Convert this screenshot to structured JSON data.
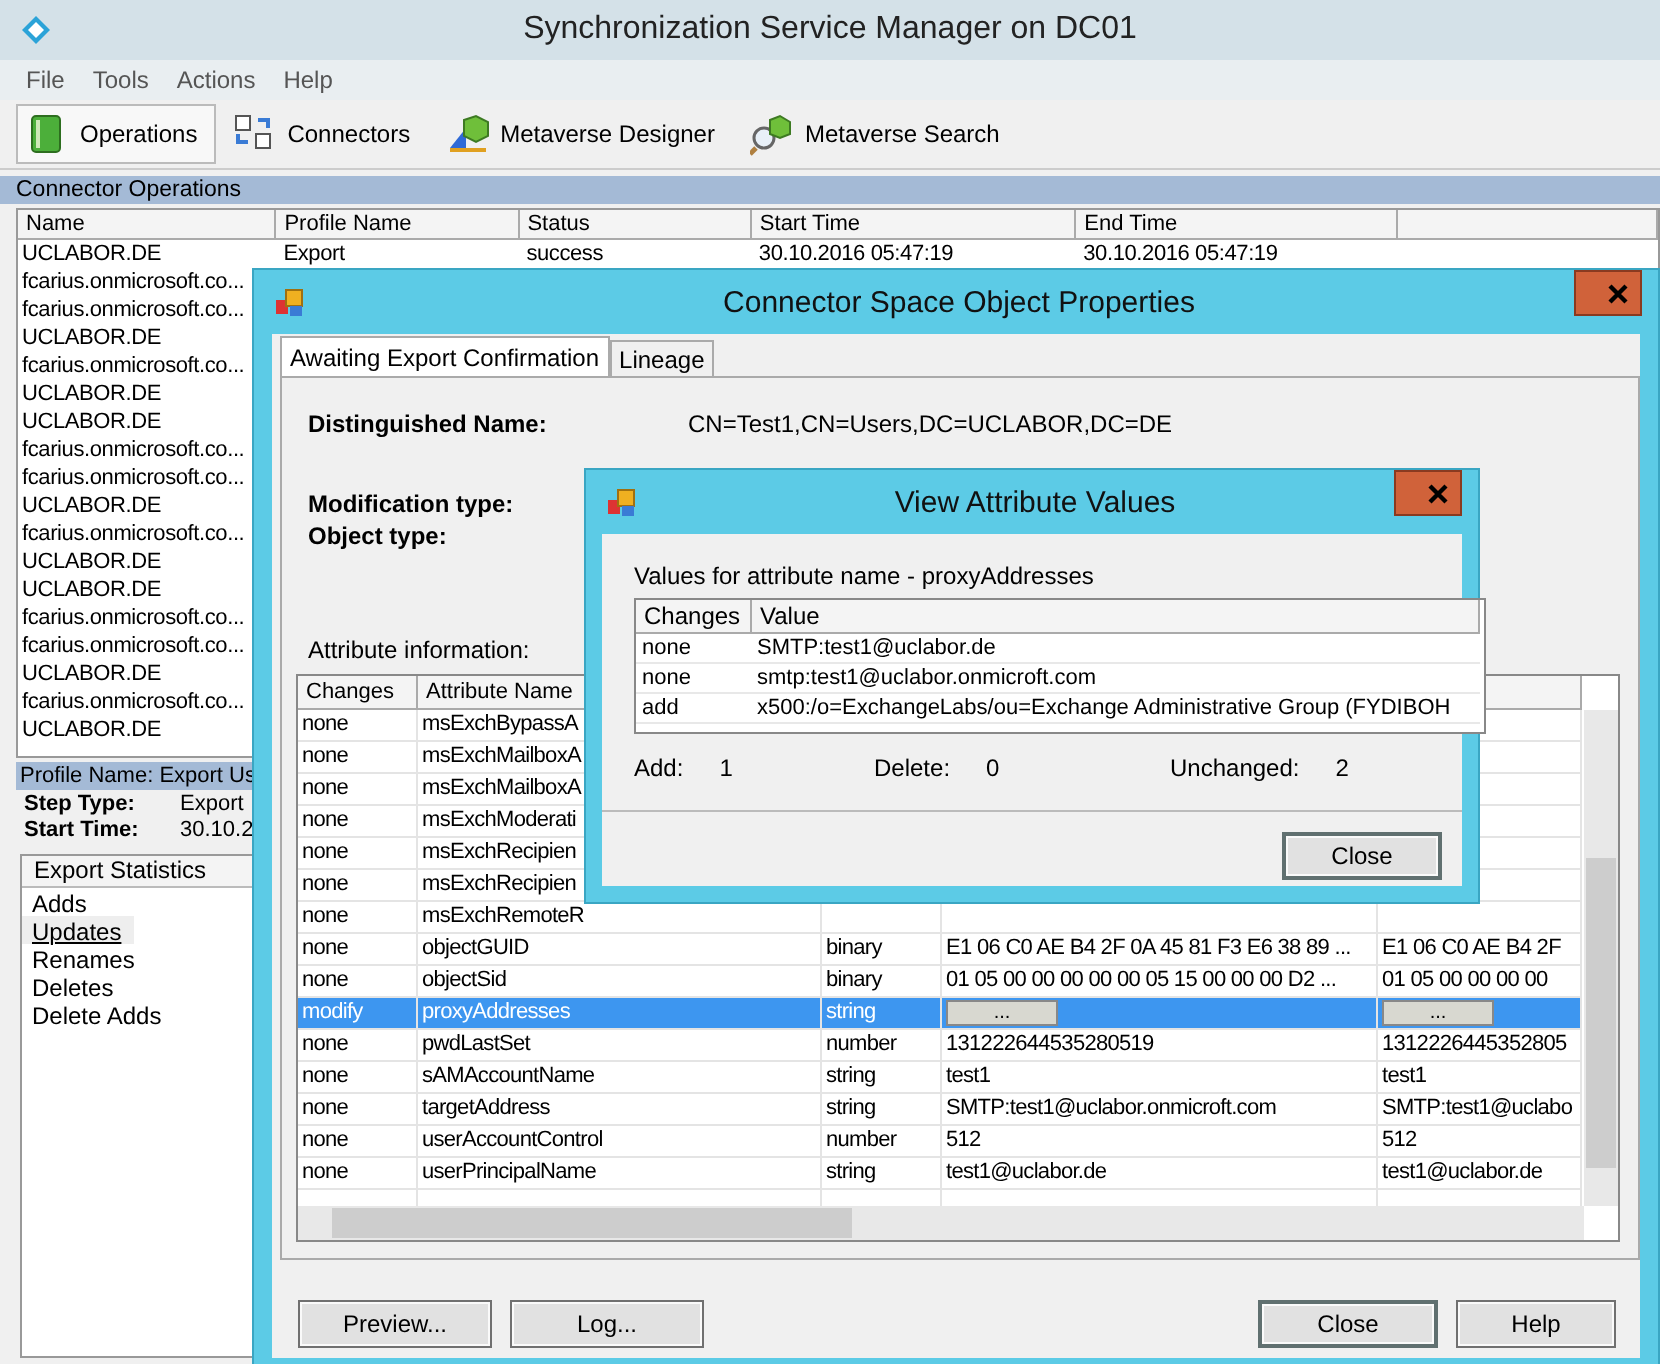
{
  "window": {
    "title": "Synchronization Service Manager on DC01"
  },
  "menu": [
    "File",
    "Tools",
    "Actions",
    "Help"
  ],
  "toolbar": [
    {
      "label": "Operations",
      "selected": true
    },
    {
      "label": "Connectors",
      "selected": false
    },
    {
      "label": "Metaverse Designer",
      "selected": false
    },
    {
      "label": "Metaverse Search",
      "selected": false
    }
  ],
  "operations": {
    "title": "Connector Operations",
    "columns": [
      "Name",
      "Profile Name",
      "Status",
      "Start Time",
      "End Time"
    ],
    "rows": [
      [
        "UCLABOR.DE",
        "Export",
        "success",
        "30.10.2016 05:47:19",
        "30.10.2016 05:47:19"
      ],
      [
        "fcarius.onmicrosoft.co..."
      ],
      [
        "fcarius.onmicrosoft.co..."
      ],
      [
        "UCLABOR.DE"
      ],
      [
        "fcarius.onmicrosoft.co..."
      ],
      [
        "UCLABOR.DE"
      ],
      [
        "UCLABOR.DE"
      ],
      [
        "fcarius.onmicrosoft.co..."
      ],
      [
        "fcarius.onmicrosoft.co..."
      ],
      [
        "UCLABOR.DE"
      ],
      [
        "fcarius.onmicrosoft.co..."
      ],
      [
        "UCLABOR.DE"
      ],
      [
        "UCLABOR.DE"
      ],
      [
        "fcarius.onmicrosoft.co..."
      ],
      [
        "fcarius.onmicrosoft.co..."
      ],
      [
        "UCLABOR.DE"
      ],
      [
        "fcarius.onmicrosoft.co..."
      ],
      [
        "UCLABOR.DE"
      ]
    ]
  },
  "profile": {
    "header": "Profile Name: Export  Us",
    "fields": [
      {
        "label": "Step Type:",
        "value": "Export"
      },
      {
        "label": "Start Time:",
        "value": "30.10.2"
      }
    ]
  },
  "statistics": {
    "header": "Export Statistics",
    "items": [
      {
        "label": "Adds",
        "selected": false
      },
      {
        "label": "Updates",
        "selected": true
      },
      {
        "label": "Renames",
        "selected": false
      },
      {
        "label": "Deletes",
        "selected": false
      },
      {
        "label": "Delete Adds",
        "selected": false
      }
    ]
  },
  "object_dialog": {
    "title": "Connector Space Object Properties",
    "tabs": [
      {
        "label": "Awaiting Export Confirmation",
        "selected": true
      },
      {
        "label": "Lineage",
        "selected": false
      }
    ],
    "distinguished_name": {
      "label": "Distinguished Name:",
      "value": "CN=Test1,CN=Users,DC=UCLABOR,DC=DE"
    },
    "labels": [
      "Modification type:",
      "Object type:"
    ],
    "attribute_caption": "Attribute information:",
    "columns": [
      "Changes",
      "Attribute Name"
    ],
    "rows": [
      {
        "kind": "text",
        "selected": false,
        "changes": "none",
        "name": "msExchBypassA"
      },
      {
        "kind": "text",
        "selected": false,
        "changes": "none",
        "name": "msExchMailboxA"
      },
      {
        "kind": "text",
        "selected": false,
        "changes": "none",
        "name": "msExchMailboxA"
      },
      {
        "kind": "text",
        "selected": false,
        "changes": "none",
        "name": "msExchModerati"
      },
      {
        "kind": "text",
        "selected": false,
        "changes": "none",
        "name": "msExchRecipien"
      },
      {
        "kind": "text",
        "selected": false,
        "changes": "none",
        "name": "msExchRecipien"
      },
      {
        "kind": "text",
        "selected": false,
        "changes": "none",
        "name": "msExchRemoteR"
      },
      {
        "kind": "text",
        "selected": false,
        "changes": "none",
        "name": "objectGUID",
        "column_3": "binary",
        "column_4": "E1 06 C0 AE B4 2F 0A 45 81 F3 E6 38 89 ...",
        "column_5": "E1 06 C0 AE B4 2F"
      },
      {
        "kind": "text",
        "selected": false,
        "changes": "none",
        "name": "objectSid",
        "column_3": "binary",
        "column_4": "01 05 00 00 00 00 00 05 15 00 00 00 D2 ...",
        "column_5": "01 05 00 00 00 00"
      },
      {
        "kind": "multivalue",
        "selected": true,
        "changes": "modify",
        "name": "proxyAddresses",
        "column_3": "string",
        "column_4": "...",
        "column_5": "..."
      },
      {
        "kind": "text",
        "selected": false,
        "changes": "none",
        "name": "pwdLastSet",
        "column_3": "number",
        "column_4": "131222644535280519",
        "column_5": "1312226445352805"
      },
      {
        "kind": "text",
        "selected": false,
        "changes": "none",
        "name": "sAMAccountName",
        "column_3": "string",
        "column_4": "test1",
        "column_5": "test1"
      },
      {
        "kind": "text",
        "selected": false,
        "changes": "none",
        "name": "targetAddress",
        "column_3": "string",
        "column_4": "SMTP:test1@uclabor.onmicroft.com",
        "column_5": "SMTP:test1@uclabo"
      },
      {
        "kind": "text",
        "selected": false,
        "changes": "none",
        "name": "userAccountControl",
        "column_3": "number",
        "column_4": "512",
        "column_5": "512"
      },
      {
        "kind": "text",
        "selected": false,
        "changes": "none",
        "name": "userPrincipalName",
        "column_3": "string",
        "column_4": "test1@uclabor.de",
        "column_5": "test1@uclabor.de"
      }
    ],
    "buttons_left": [
      "Preview...",
      "Log..."
    ],
    "buttons_right": [
      "Close",
      "Help"
    ]
  },
  "values_dialog": {
    "title": "View Attribute Values",
    "caption": "Values for attribute name - proxyAddresses",
    "columns": [
      "Changes",
      "Value"
    ],
    "rows": [
      [
        "none",
        "SMTP:test1@uclabor.de"
      ],
      [
        "none",
        "smtp:test1@uclabor.onmicroft.com"
      ],
      [
        "add",
        "x500:/o=ExchangeLabs/ou=Exchange Administrative Group (FYDIBOH"
      ]
    ],
    "counts": [
      {
        "label": "Add:",
        "value": "1"
      },
      {
        "label": "Delete:",
        "value": "0"
      },
      {
        "label": "Unchanged:",
        "value": "2"
      }
    ],
    "button": "Close"
  }
}
